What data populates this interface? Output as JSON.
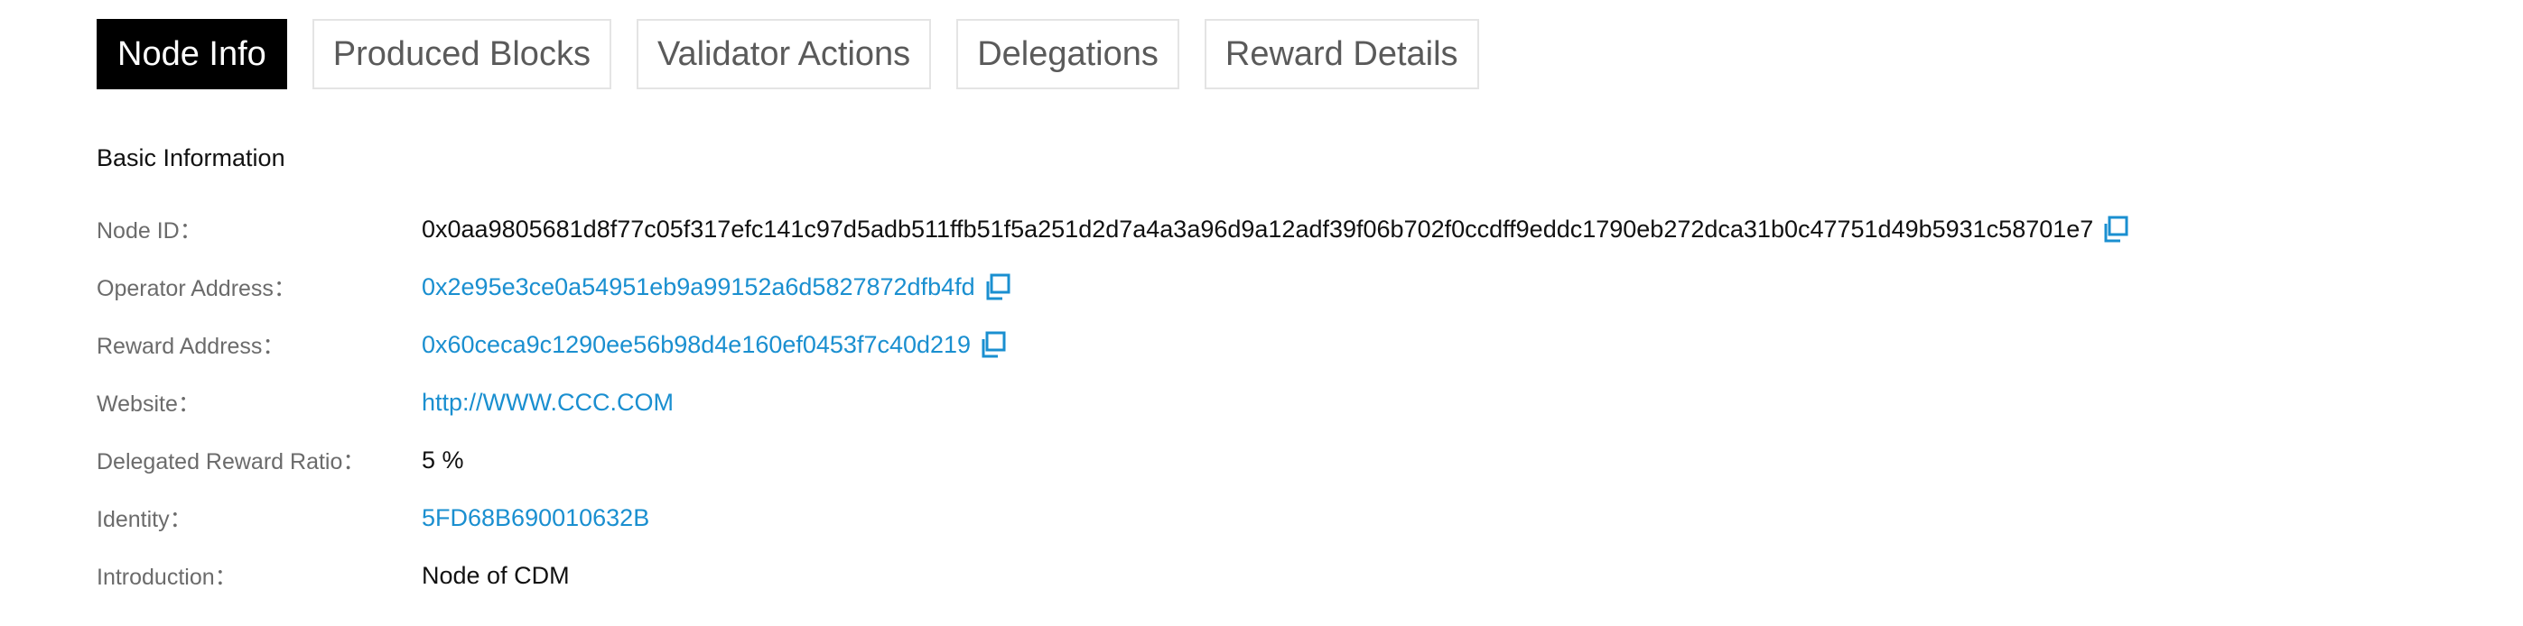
{
  "tabs": [
    {
      "label": "Node Info",
      "active": true
    },
    {
      "label": "Produced Blocks",
      "active": false
    },
    {
      "label": "Validator Actions",
      "active": false
    },
    {
      "label": "Delegations",
      "active": false
    },
    {
      "label": "Reward Details",
      "active": false
    }
  ],
  "basic_info": {
    "title": "Basic Information",
    "node_id": {
      "label": "Node ID：",
      "value": "0x0aa9805681d8f77c05f317efc141c97d5adb511ffb51f5a251d2d7a4a3a96d9a12adf39f06b702f0ccdff9eddc1790eb272dca31b0c47751d49b5931c58701e7"
    },
    "operator_address": {
      "label": "Operator Address：",
      "value": "0x2e95e3ce0a54951eb9a99152a6d5827872dfb4fd"
    },
    "reward_address": {
      "label": "Reward Address：",
      "value": "0x60ceca9c1290ee56b98d4e160ef0453f7c40d219"
    },
    "website": {
      "label": "Website：",
      "value": "http://WWW.CCC.COM"
    },
    "delegated_reward_ratio": {
      "label": "Delegated Reward Ratio：",
      "value": "5 %"
    },
    "identity": {
      "label": "Identity：",
      "value": "5FD68B690010632B"
    },
    "introduction": {
      "label": "Introduction：",
      "value": "Node of CDM"
    }
  },
  "icons": {
    "copy": "copy-icon"
  },
  "colors": {
    "link": "#1a8fd0",
    "active_tab_bg": "#000000",
    "active_tab_text": "#ffffff",
    "tab_border": "#e4e4e4",
    "label_text": "#6b6b6b"
  }
}
